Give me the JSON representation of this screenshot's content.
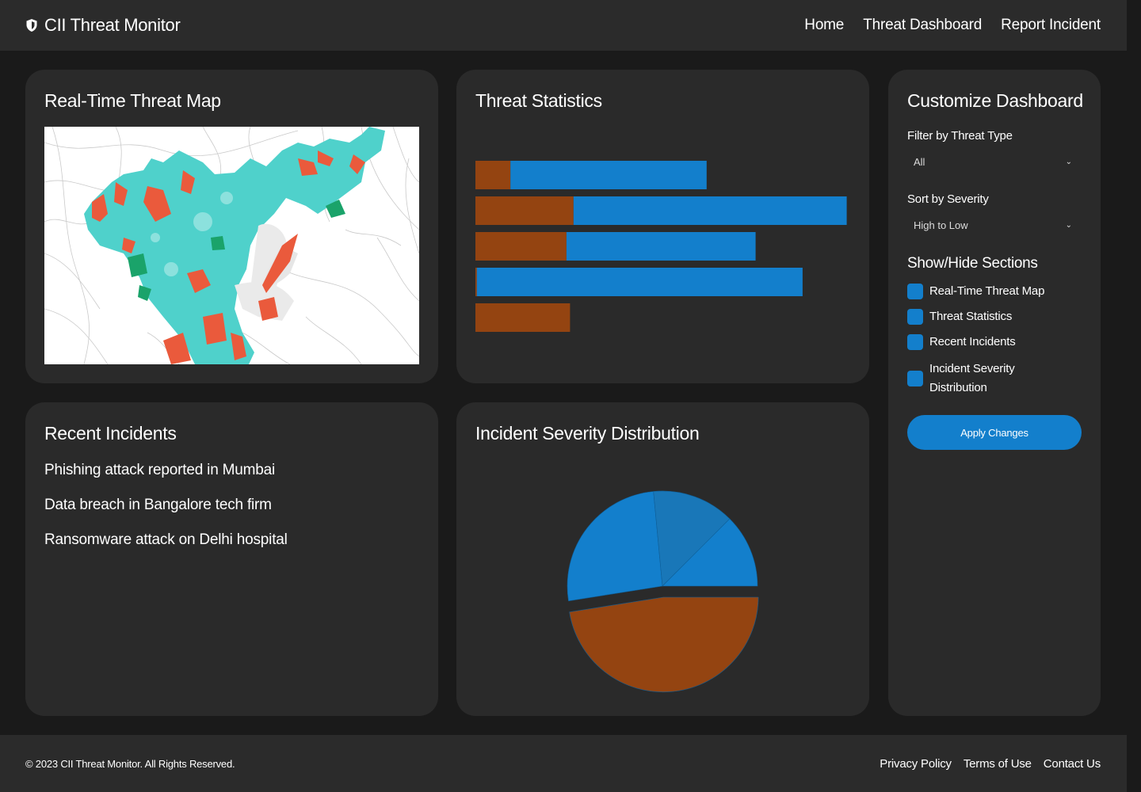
{
  "header": {
    "brand_icon": "shield-icon",
    "brand": "CII Threat Monitor",
    "nav": [
      {
        "label": "Home"
      },
      {
        "label": "Threat Dashboard"
      },
      {
        "label": "Report Incident"
      }
    ]
  },
  "map": {
    "title": "Real-Time Threat Map"
  },
  "stats": {
    "title": "Threat Statistics",
    "colors": {
      "series_a": "#944411",
      "series_b": "#137fcc"
    }
  },
  "chart_data": [
    {
      "type": "bar",
      "orientation": "horizontal",
      "stacked": true,
      "categories": [
        "",
        "",
        "",
        "",
        ""
      ],
      "series": [
        {
          "values": [
            10,
            28,
            26,
            0.4,
            27
          ]
        },
        {
          "values": [
            56,
            78,
            54,
            93,
            0
          ]
        }
      ],
      "xlim": [
        0,
        107
      ],
      "grid": false,
      "legend": "none",
      "colors": [
        "#944411",
        "#137fcc"
      ]
    },
    {
      "type": "pie",
      "values": [
        47.5,
        26,
        14,
        12.5
      ],
      "colors": [
        "#944411",
        "#137fcc",
        "#1977b8",
        "#137fcc"
      ],
      "exploded": [
        true,
        false,
        false,
        false
      ],
      "legend": "none"
    }
  ],
  "recent": {
    "title": "Recent Incidents",
    "items": [
      "Phishing attack reported in Mumbai",
      "Data breach in Bangalore tech firm",
      "Ransomware attack on Delhi hospital"
    ]
  },
  "pie": {
    "title": "Incident Severity Distribution"
  },
  "customize": {
    "title": "Customize Dashboard",
    "filter_label": "Filter by Threat Type",
    "filter_value": "All",
    "sort_label": "Sort by Severity",
    "sort_value": "High to Low",
    "sections_title": "Show/Hide Sections",
    "sections": [
      {
        "label": "Real-Time Threat Map",
        "checked": true
      },
      {
        "label": "Threat Statistics",
        "checked": true
      },
      {
        "label": "Recent Incidents",
        "checked": true
      },
      {
        "label": "Incident Severity Distribution",
        "checked": true
      }
    ],
    "apply_label": "Apply Changes",
    "accent": "#137fcc"
  },
  "footer": {
    "copyright": "© 2023 CII Threat Monitor. All Rights Reserved.",
    "links": [
      "Privacy Policy",
      "Terms of Use",
      "Contact Us"
    ]
  }
}
